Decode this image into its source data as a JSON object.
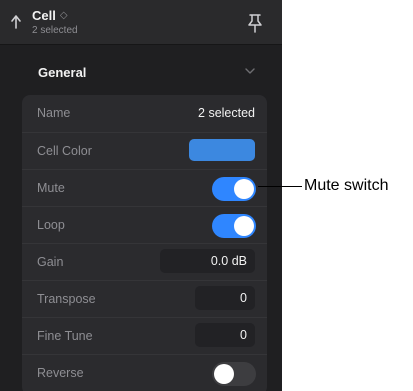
{
  "header": {
    "title": "Cell",
    "title_chevron": "◇",
    "subtitle": "2 selected"
  },
  "section": {
    "title": "General"
  },
  "rows": {
    "name": {
      "label": "Name",
      "value": "2 selected"
    },
    "cell_color": {
      "label": "Cell Color",
      "color": "#3c88e0"
    },
    "mute": {
      "label": "Mute",
      "on": true
    },
    "loop": {
      "label": "Loop",
      "on": true
    },
    "gain": {
      "label": "Gain",
      "value": "0.0 dB"
    },
    "transpose": {
      "label": "Transpose",
      "value": "0"
    },
    "fine_tune": {
      "label": "Fine Tune",
      "value": "0"
    },
    "reverse": {
      "label": "Reverse",
      "on": false
    }
  },
  "callout": {
    "text": "Mute switch"
  },
  "colors": {
    "accent": "#2f86ff",
    "panel_bg": "#1f1f21",
    "card_bg": "#2b2b2e"
  },
  "icons": [
    "back-arrow-icon",
    "pin-icon",
    "chevron-down-icon",
    "updown-chevron-icon"
  ]
}
